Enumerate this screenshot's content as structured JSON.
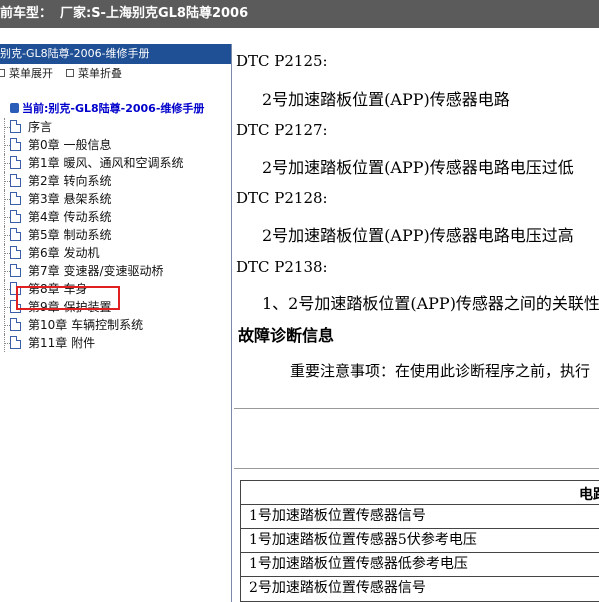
{
  "topbar": {
    "label": "前车型：",
    "value": "厂家:S-上海别克GL8陆尊2006"
  },
  "sidebar": {
    "title": "别克-GL8陆尊-2006-维修手册",
    "expand_label": "菜单展开",
    "collapse_label": "菜单折叠",
    "root_label": "当前:别克-GL8陆尊-2006-维修手册",
    "items": [
      {
        "label": "序言"
      },
      {
        "label": "第0章 一般信息"
      },
      {
        "label": "第1章 暖风、通风和空调系统"
      },
      {
        "label": "第2章 转向系统"
      },
      {
        "label": "第3章 悬架系统"
      },
      {
        "label": "第4章 传动系统"
      },
      {
        "label": "第5章 制动系统"
      },
      {
        "label": "第6章 发动机"
      },
      {
        "label": "第7章 变速器/变速驱动桥"
      },
      {
        "label": "第8章 车身"
      },
      {
        "label": "第9章 保护装置"
      },
      {
        "label": "第10章 车辆控制系统"
      },
      {
        "label": "第11章 附件"
      }
    ],
    "selected_index": 7
  },
  "content": {
    "dtcs": [
      {
        "code": "DTC P2125:",
        "desc": "2号加速踏板位置(APP)传感器电路"
      },
      {
        "code": "DTC P2127:",
        "desc": "2号加速踏板位置(APP)传感器电路电压过低"
      },
      {
        "code": "DTC P2128:",
        "desc": "2号加速踏板位置(APP)传感器电路电压过高"
      },
      {
        "code": "DTC P2138:",
        "desc": "1、2号加速踏板位置(APP)传感器之间的关联性"
      }
    ],
    "heading": "故障诊断信息",
    "notice": "重要注意事项：在使用此诊断程序之前，执行",
    "table": {
      "header": "电路",
      "rows": [
        "1号加速踏板位置传感器信号",
        "1号加速踏板位置传感器5伏参考电压",
        "1号加速踏板位置传感器低参考电压",
        "2号加速踏板位置传感器信号"
      ]
    }
  },
  "colors": {
    "topbar_bg": "#5b5b5b",
    "sidebar_header_bg": "#1f4f95",
    "root_text": "#0000cc",
    "highlight_border": "#e02020"
  }
}
